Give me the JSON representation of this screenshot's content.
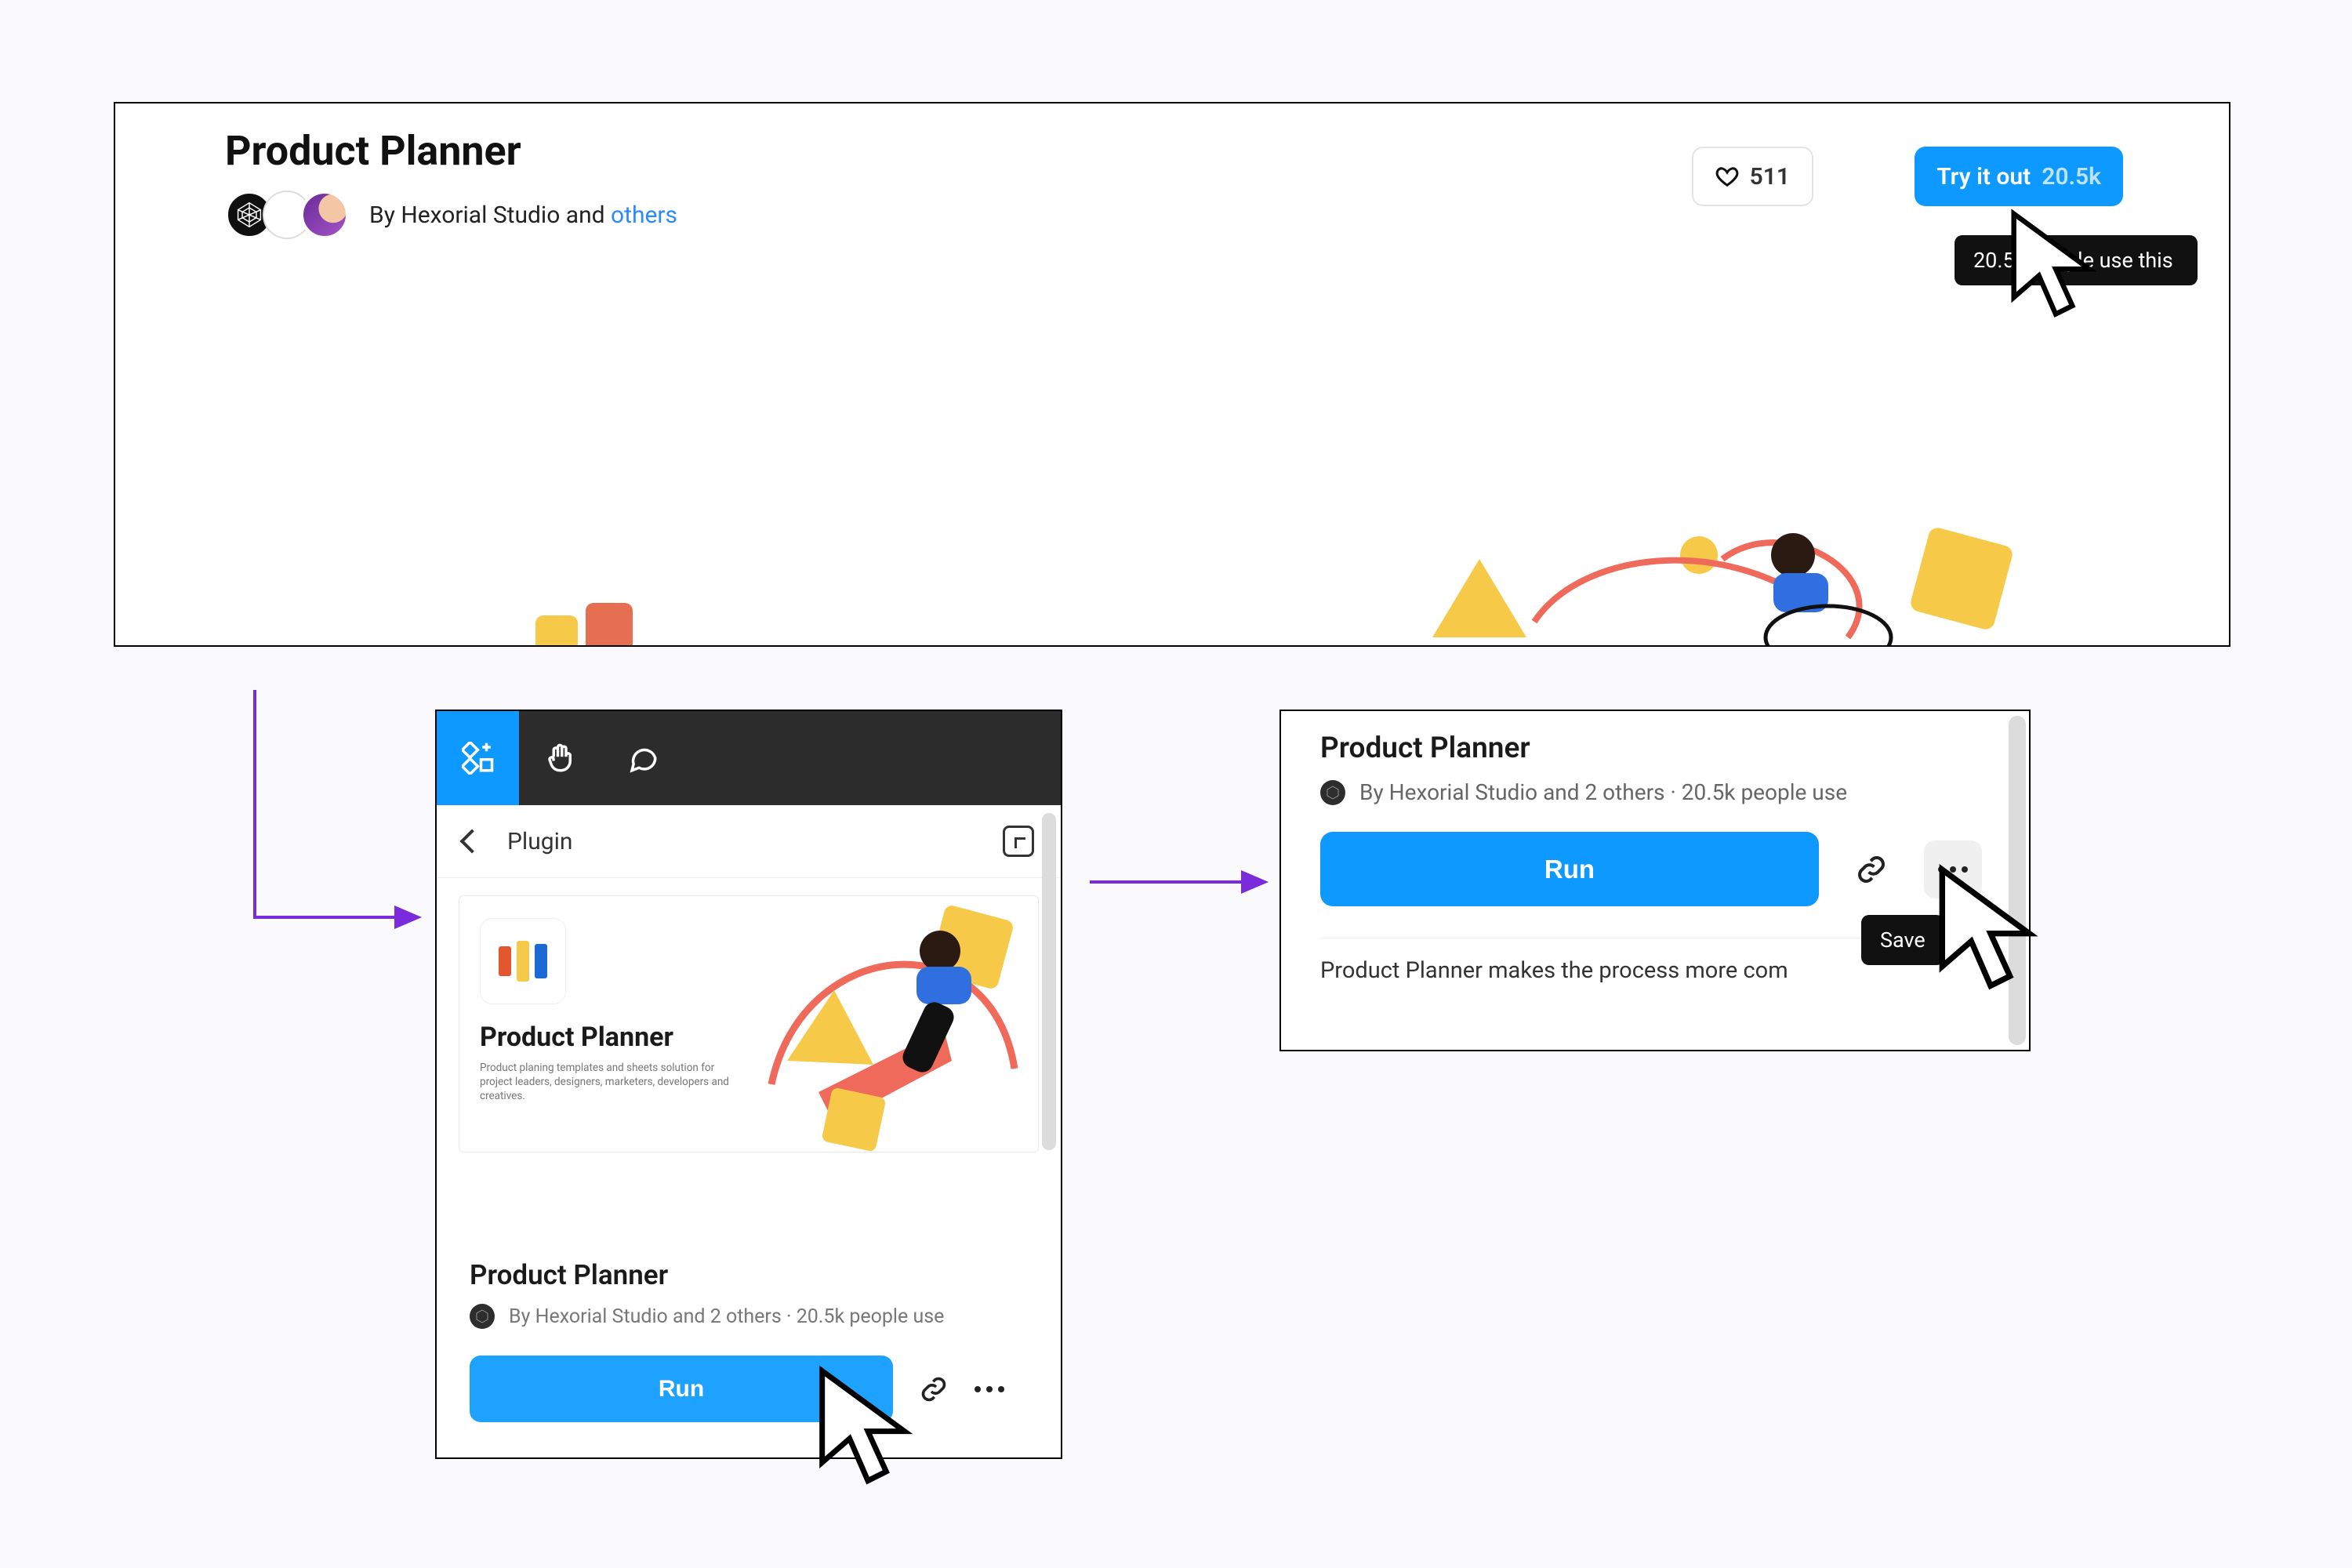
{
  "top": {
    "title": "Product Planner",
    "by_prefix": "By Hexorial Studio and ",
    "others_link": "others",
    "like_count": "511",
    "try_label": "Try it out",
    "try_count": "20.5k",
    "tooltip": "20.5k people use this"
  },
  "mid": {
    "toolbar_label": "Plugin",
    "hero_title": "Product Planner",
    "hero_sub": "Product planing templates and sheets solution for project leaders, designers, marketers, developers and creatives.",
    "name": "Product Planner",
    "byline": "By Hexorial Studio and 2 others · 20.5k people use",
    "run_label": "Run"
  },
  "right": {
    "title": "Product Planner",
    "byline": "By Hexorial Studio and 2 others · 20.5k people use",
    "run_label": "Run",
    "save_label": "Save",
    "desc": "Product Planner makes the process more com"
  }
}
